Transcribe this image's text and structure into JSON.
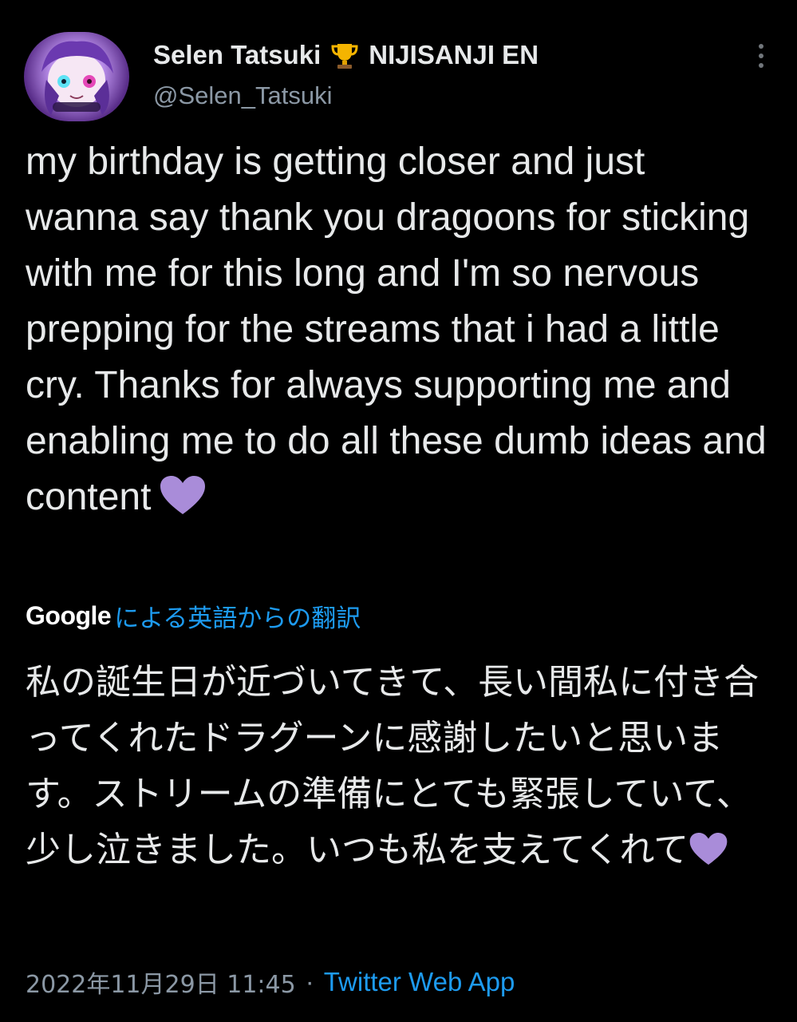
{
  "author": {
    "display_name": "Selen Tatsuki",
    "badge_icon": "trophy-icon",
    "affiliation": "NIJISANJI EN",
    "handle": "@Selen_Tatsuki"
  },
  "tweet": {
    "text": "my birthday is getting closer and just wanna say thank you dragoons for sticking with me for this long and I'm so nervous prepping for the streams that i had a little cry. Thanks for always supporting me and enabling me to do all these dumb ideas and content",
    "emoji": "purple-heart-icon"
  },
  "translation": {
    "provider": "Google",
    "label": "による英語からの翻訳",
    "text": "私の誕生日が近づいてきて、長い間私に付き合ってくれたドラグーンに感謝したいと思います。ストリームの準備にとても緊張していて、少し泣きました。いつも私を支えてくれて"
  },
  "meta": {
    "timestamp": "2022年11月29日 11:45",
    "separator": "·",
    "source": "Twitter Web App"
  },
  "colors": {
    "background": "#000000",
    "text": "#e7e9ea",
    "secondary_text": "#8b98a5",
    "link": "#1d9bf0",
    "heart": "#a98cd9"
  }
}
